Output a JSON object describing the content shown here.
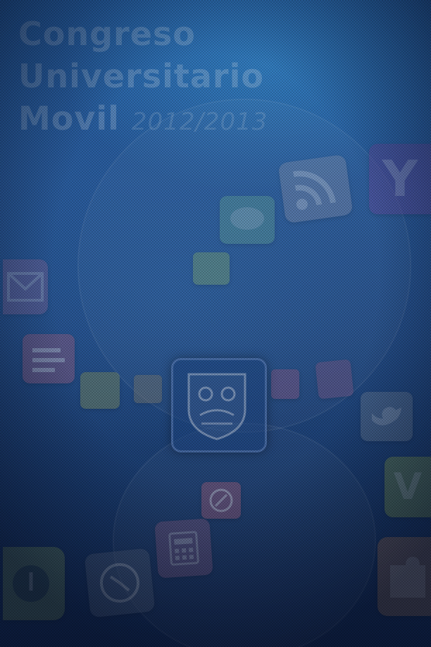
{
  "splash": {
    "title_line1": "Congreso",
    "title_line2": "Universitario",
    "title_line3_main": "Movil",
    "title_line3_year": "2012/2013"
  },
  "colors": {
    "background_top": "#2762a7",
    "background_bottom": "#112851",
    "title_text": "rgba(255,255,255,0.20)"
  },
  "icons": [
    {
      "name": "rss-icon",
      "color": "#7f8fb0"
    },
    {
      "name": "yahoo-icon",
      "color": "#5c4fa0"
    },
    {
      "name": "messages-icon",
      "color": "#5f9f9a"
    },
    {
      "name": "notes-icon",
      "color": "#74a07a"
    },
    {
      "name": "email-icon",
      "color": "#8a6a9c"
    },
    {
      "name": "contacts-icon",
      "color": "#8d5f86"
    },
    {
      "name": "photos-icon",
      "color": "#7a8a62"
    },
    {
      "name": "news-icon",
      "color": "#7b7a70"
    },
    {
      "name": "university-shield-icon",
      "color": "#2c5598"
    },
    {
      "name": "weather-icon",
      "color": "#7c5a88"
    },
    {
      "name": "bookmark-icon",
      "color": "#7c5a88"
    },
    {
      "name": "twitter-icon",
      "color": "#6b7f99"
    },
    {
      "name": "vine-icon",
      "color": "#6f8a55"
    },
    {
      "name": "browser-icon",
      "color": "#8a5a7a"
    },
    {
      "name": "calculator-icon",
      "color": "#7e5c84"
    },
    {
      "name": "maps-icon",
      "color": "#6c8a5f"
    },
    {
      "name": "clock-icon",
      "color": "#4d5f7d"
    },
    {
      "name": "puzzle-icon",
      "color": "#8a6a5a"
    }
  ]
}
